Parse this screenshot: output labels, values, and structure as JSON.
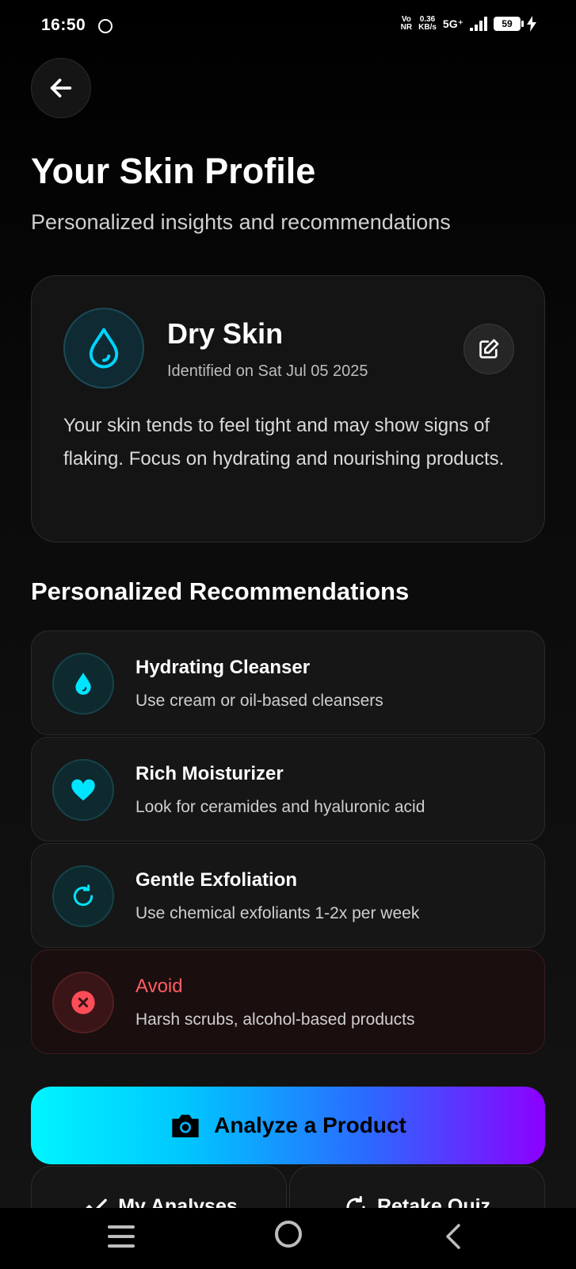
{
  "status_bar": {
    "time": "16:50",
    "net_line1": "Vo",
    "net_line2": "NR",
    "speed_value": "0.36",
    "speed_unit": "KB/s",
    "network": "5G⁺",
    "battery": "59"
  },
  "header": {
    "title": "Your Skin Profile",
    "subtitle": "Personalized insights and recommendations"
  },
  "profile": {
    "skin_type": "Dry Skin",
    "identified": "Identified on Sat Jul 05 2025",
    "description": "Your skin tends to feel tight and may show signs of flaking. Focus on hydrating and nourishing products.",
    "icon": "water-drop-icon"
  },
  "recommendations": {
    "section_title": "Personalized Recommendations",
    "items": [
      {
        "title": "Hydrating Cleanser",
        "desc": "Use cream or oil-based cleansers",
        "icon": "droplet-icon"
      },
      {
        "title": "Rich Moisturizer",
        "desc": "Look for ceramides and hyaluronic acid",
        "icon": "heart-icon"
      },
      {
        "title": "Gentle Exfoliation",
        "desc": "Use chemical exfoliants 1-2x per week",
        "icon": "refresh-icon"
      },
      {
        "title": "Avoid",
        "desc": "Harsh scrubs, alcohol-based products",
        "icon": "close-circle-icon"
      }
    ]
  },
  "actions": {
    "analyze_label": "Analyze a Product",
    "analyses_label": "My Analyses",
    "retake_label": "Retake Quiz"
  },
  "colors": {
    "accent_cyan": "#00e5ff",
    "accent_purple": "#8c00ff",
    "avoid_red": "#ff5d62",
    "background": "#000000"
  }
}
